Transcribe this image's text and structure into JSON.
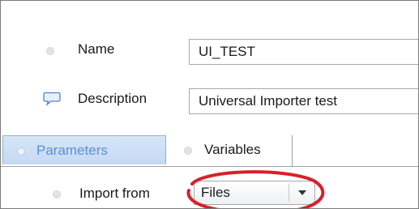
{
  "form": {
    "name": {
      "label": "Name",
      "value": "UI_TEST"
    },
    "description": {
      "label": "Description",
      "value": "Universal Importer test",
      "icon": "speech-bubble-icon"
    },
    "import_from": {
      "label": "Import from",
      "value": "Files"
    }
  },
  "tabs": [
    {
      "label": "Parameters",
      "active": true
    },
    {
      "label": "Variables",
      "active": false
    }
  ],
  "colors": {
    "active_tab_text": "#5a8fd4",
    "active_tab_bg": "#c4d9f2",
    "annotation_circle": "#d9202a"
  }
}
